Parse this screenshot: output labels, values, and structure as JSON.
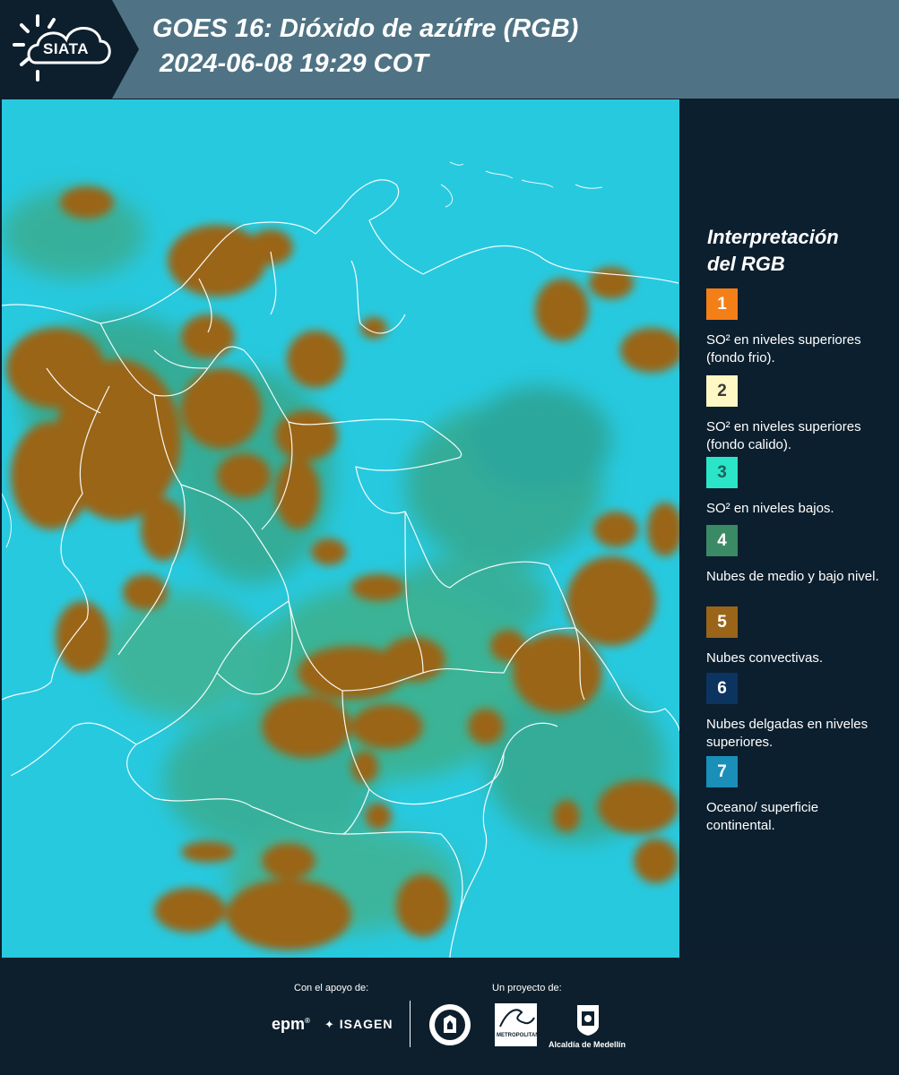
{
  "header": {
    "logo_text": "SIATA",
    "title": "GOES 16: Dióxido de azúfre (RGB)",
    "timestamp": "2024-06-08 19:29 COT"
  },
  "legend": {
    "title_line1": "Interpretación",
    "title_line2": "del RGB",
    "items": [
      {
        "number": "1",
        "color": "#f57f17",
        "text_color": "#ffffff",
        "label": "SO² en niveles superiores (fondo frio)."
      },
      {
        "number": "2",
        "color": "#fff8c4",
        "text_color": "#3a3a3a",
        "label": "SO² en niveles superiores (fondo calido)."
      },
      {
        "number": "3",
        "color": "#2ae5c8",
        "text_color": "#1f5f5a",
        "label": "SO² en niveles bajos."
      },
      {
        "number": "4",
        "color": "#3a8a65",
        "text_color": "#ffffff",
        "label": "Nubes de medio y bajo nivel."
      },
      {
        "number": "5",
        "color": "#9a6518",
        "text_color": "#ffffff",
        "label": "Nubes convectivas."
      },
      {
        "number": "6",
        "color": "#0c3461",
        "text_color": "#ffffff",
        "label": "Nubes delgadas en niveles superiores."
      },
      {
        "number": "7",
        "color": "#1a8fb8",
        "text_color": "#ffffff",
        "label": "Oceano/ superficie continental."
      }
    ]
  },
  "footer": {
    "support_label": "Con el apoyo de:",
    "project_label": "Un proyecto de:",
    "sponsors": [
      "epm",
      "ISAGEN"
    ],
    "partners": [
      "Área Metropolitana Valle de Aburrá",
      "Alcaldía de Medellín"
    ],
    "area_caption": "METROPOLITANA",
    "alcaldia_caption": "Alcaldía de Medellín"
  },
  "colors": {
    "header_bg": "#4f7384",
    "sidebar_bg": "#0c1f2e",
    "ocean": "#27c9df",
    "cloud_convective": "#9a6518"
  }
}
